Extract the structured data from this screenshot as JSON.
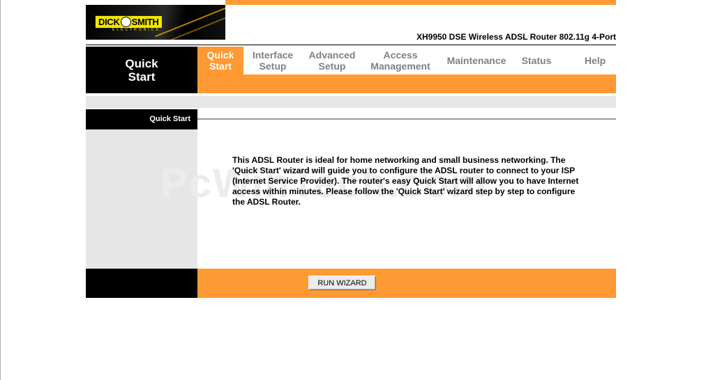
{
  "header": {
    "logo_text_left": "DICK",
    "logo_text_right": "SMITH",
    "logo_subtext": "ELECTRONICS",
    "model_title": "XH9950 DSE Wireless ADSL Router 802.11g 4-Port"
  },
  "nav": {
    "current_section": "Quick Start",
    "tabs": [
      {
        "label": "Quick Start",
        "active": true
      },
      {
        "label": "Interface Setup",
        "active": false
      },
      {
        "label": "Advanced Setup",
        "active": false
      },
      {
        "label": "Access Management",
        "active": false
      },
      {
        "label": "Maintenance",
        "active": false
      },
      {
        "label": "Status",
        "active": false
      },
      {
        "label": "Help",
        "active": false
      }
    ]
  },
  "content": {
    "side_heading": "Quick Start",
    "intro_text": "This ADSL Router is ideal for home networking and small business networking. The 'Quick Start' wizard will guide you to configure the ADSL router to connect to your ISP (Internet Service Provider). The router's easy Quick Start will allow you to have Internet access within minutes. Please follow the 'Quick Start' wizard step by step to configure the ADSL Router.",
    "watermark": "PcWinTech.com"
  },
  "footer": {
    "run_wizard_label": "RUN WIZARD"
  },
  "colors": {
    "accent_orange": "#ff9933",
    "panel_black": "#000000",
    "panel_gray": "#e6e6e6",
    "tab_inactive_text": "#808080"
  }
}
